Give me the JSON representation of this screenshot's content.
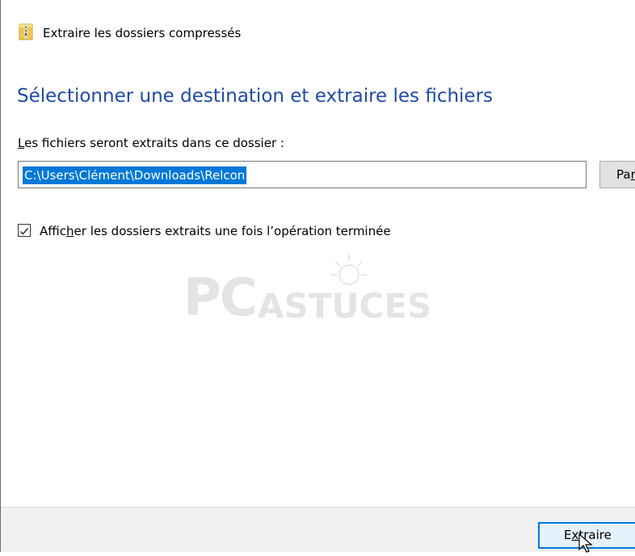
{
  "window": {
    "title": "Extraire les dossiers compressés",
    "icon": "zip-folder-icon"
  },
  "main": {
    "heading": "Sélectionner une destination et extraire les fichiers",
    "folder_label_underlined": "L",
    "folder_label_rest": "es fichiers seront extraits dans ce dossier :",
    "path_value": "C:\\Users\\Clément\\Downloads\\Relcon",
    "browse_label_first": "Pa",
    "browse_label_underlined": "r",
    "checkbox": {
      "checked": true,
      "label_before": "Affic",
      "label_underlined": "h",
      "label_after": "er les dossiers extraits une fois l’opération terminée"
    }
  },
  "watermark": {
    "text_pc": "PC",
    "text_astuces": "ASTUCES"
  },
  "footer": {
    "extract_label_first": "E",
    "extract_label_underlined": "x",
    "extract_label_rest": "traire"
  },
  "colors": {
    "heading": "#1f4aa8",
    "selection": "#0078d7",
    "footer_bg": "#f0f0f0",
    "button_focus_border": "#0078d7"
  }
}
